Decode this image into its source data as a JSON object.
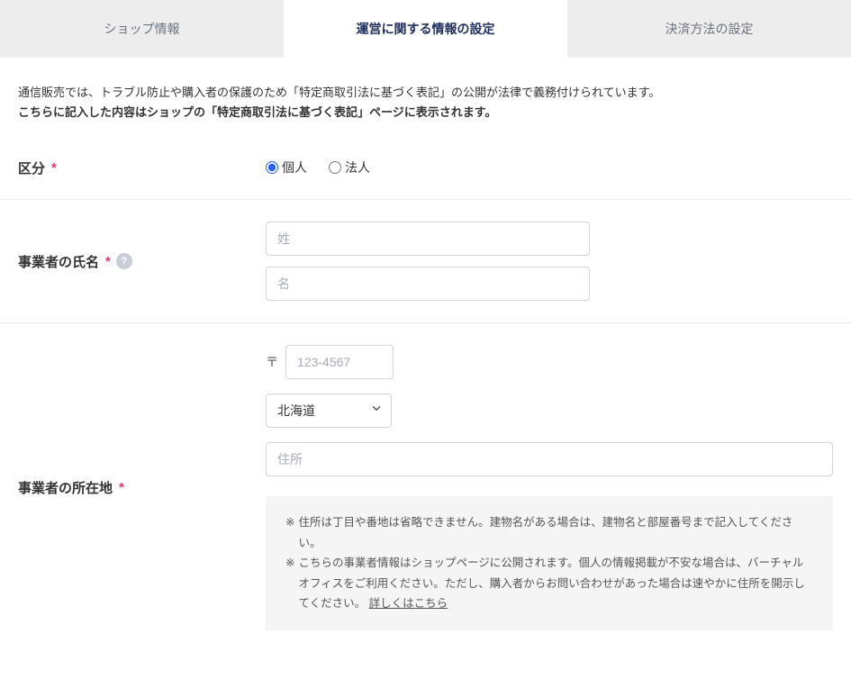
{
  "tabs": {
    "shop_info": "ショップ情報",
    "operation_settings": "運営に関する情報の設定",
    "payment_settings": "決済方法の設定"
  },
  "intro": {
    "line1": "通信販売では、トラブル防止や購入者の保護のため「特定商取引法に基づく表記」の公開が法律で義務付けられています。",
    "line2": "こちらに記入した内容はショップの「特定商取引法に基づく表記」ページに表示されます。"
  },
  "form": {
    "category": {
      "label": "区分",
      "individual": "個人",
      "corporation": "法人"
    },
    "operator_name": {
      "label": "事業者の氏名",
      "last_placeholder": "姓",
      "first_placeholder": "名"
    },
    "operator_address": {
      "label": "事業者の所在地",
      "postal_mark": "〒",
      "postal_placeholder": "123-4567",
      "prefecture_selected": "北海道",
      "address_placeholder": "住所"
    }
  },
  "notes": {
    "marker": "※",
    "line1": "住所は丁目や番地は省略できません。建物名がある場合は、建物名と部屋番号まで記入してください。",
    "line2": "こちらの事業者情報はショップページに公開されます。個人の情報掲載が不安な場合は、バーチャルオフィスをご利用ください。ただし、購入者からお問い合わせがあった場合は速やかに住所を開示してください。",
    "link": "詳しくはこちら"
  }
}
